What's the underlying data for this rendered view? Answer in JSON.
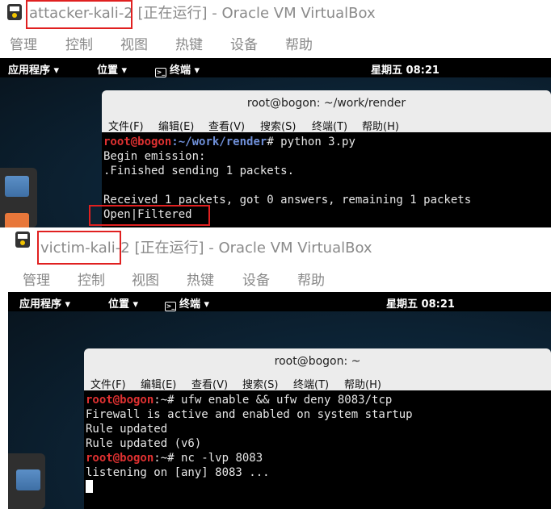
{
  "attacker": {
    "vm_name": "attacker-kali-2",
    "title_rest": " [正在运行] - Oracle VM VirtualBox",
    "menu": [
      "管理",
      "控制",
      "视图",
      "热键",
      "设备",
      "帮助"
    ],
    "panel": {
      "apps": "应用程序 ▾",
      "places": "位置 ▾",
      "terminal": "终端 ▾",
      "clock": "星期五 08:21"
    },
    "terminal": {
      "title": "root@bogon: ~/work/render",
      "menu": [
        "文件(F)",
        "编辑(E)",
        "查看(V)",
        "搜索(S)",
        "终端(T)",
        "帮助(H)"
      ],
      "prompt_user": "root@bogon",
      "prompt_path": ":~/work/render",
      "prompt_end": "# ",
      "command": "python 3.py",
      "lines": [
        "Begin emission:",
        ".Finished sending 1 packets.",
        "",
        "Received 1 packets, got 0 answers, remaining 1 packets",
        "Open|Filtered"
      ]
    }
  },
  "victim": {
    "vm_name": "victim-kali-2",
    "title_rest": " [正在运行] - Oracle VM VirtualBox",
    "menu": [
      "管理",
      "控制",
      "视图",
      "热键",
      "设备",
      "帮助"
    ],
    "panel": {
      "apps": "应用程序 ▾",
      "places": "位置 ▾",
      "terminal": "终端 ▾",
      "clock": "星期五 08:21"
    },
    "terminal": {
      "title": "root@bogon: ~",
      "menu": [
        "文件(F)",
        "编辑(E)",
        "查看(V)",
        "搜索(S)",
        "终端(T)",
        "帮助(H)"
      ],
      "prompt_user": "root@bogon",
      "prompt_path": ":~",
      "prompt_end": "# ",
      "command1": "ufw enable && ufw deny 8083/tcp",
      "output1": [
        "Firewall is active and enabled on system startup",
        "Rule updated",
        "Rule updated (v6)"
      ],
      "command2": "nc -lvp 8083",
      "output2": "listening on [any] 8083 ..."
    }
  },
  "colors": {
    "highlight": "#e02020",
    "prompt_user": "#e03131",
    "prompt_path": "#6f8fd8"
  }
}
